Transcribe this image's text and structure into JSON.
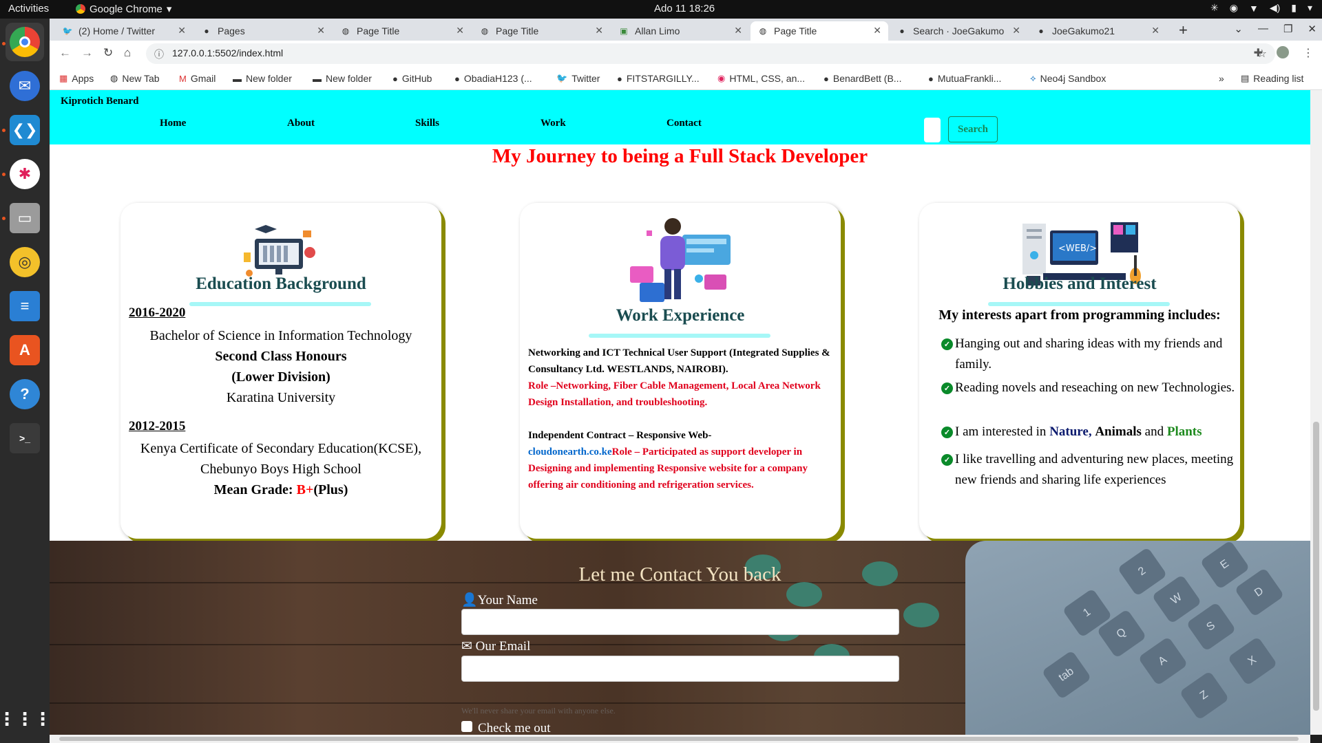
{
  "system": {
    "activities": "Activities",
    "app_name": "Google Chrome",
    "clock": "Ado 11  18:26"
  },
  "browser": {
    "tabs": [
      {
        "title": "(2) Home / Twitter",
        "icon": "twitter-icon"
      },
      {
        "title": "Pages",
        "icon": "github-icon"
      },
      {
        "title": "Page Title",
        "icon": "globe-icon"
      },
      {
        "title": "Page Title",
        "icon": "globe-icon"
      },
      {
        "title": "Allan Limo",
        "icon": "page-icon"
      },
      {
        "title": "Page Title",
        "icon": "globe-icon",
        "active": true
      },
      {
        "title": "Search · JoeGakumo",
        "icon": "github-icon"
      },
      {
        "title": "JoeGakumo21",
        "icon": "github-icon"
      }
    ],
    "url": "127.0.0.1:5502/index.html",
    "bookmarks": [
      "Apps",
      "New Tab",
      "Gmail",
      "New folder",
      "New folder",
      "GitHub",
      "ObadiaH123 (...",
      "Twitter",
      "FITSTARGILLY...",
      "HTML, CSS, an...",
      "BenardBett (B...",
      "MutuaFrankli...",
      "Neo4j Sandbox"
    ],
    "more_bookmarks": "»",
    "reading_list": "Reading list"
  },
  "site": {
    "brand": "Kiprotich Benard",
    "nav": [
      "Home",
      "About",
      "Skills",
      "Work",
      "Contact"
    ],
    "search_label": "Search",
    "heading": "My Journey to being a Full Stack Developer",
    "education": {
      "title": "Education Background",
      "year1": "2016-2020",
      "degree": "Bachelor of Science in Information Technology",
      "honours": "Second Class Honours",
      "division": "(Lower Division)",
      "university": "Karatina University",
      "year2": "2012-2015",
      "kcse": "Kenya Certificate of Secondary Education(KCSE),",
      "school": "Chebunyo Boys High School",
      "grade_label": "Mean Grade: ",
      "grade_value": "B+",
      "grade_suffix": "(Plus)"
    },
    "work": {
      "title": "Work Experience",
      "job1": "Networking and ICT Technical User Support (Integrated Supplies & Consultancy Ltd. WESTLANDS, NAIROBI).",
      "job1_role": "Role –Networking, Fiber Cable Management, Local Area Network Design Installation, and troubleshooting.",
      "job2": "Independent Contract – Responsive Web-",
      "job2_link": "cloudonearth.co.ke",
      "job2_role": "Role – Participated as support developer in Designing and implementing Responsive website for a company offering air conditioning and refrigeration services."
    },
    "hobbies": {
      "title": "Hobbies and Interest",
      "intro": "My interests apart from programming includes:",
      "item1": "Hanging out and sharing ideas with my friends and family.",
      "item2": "Reading novels and reseaching on new Technologies.",
      "item3_pre": "I am interested in ",
      "item3_a": "Nature,",
      "item3_b": "Animals",
      "item3_and": " and ",
      "item3_c": "Plants",
      "item4": "I like travelling and adventuring new places, meeting new friends and sharing life experiences"
    },
    "contact": {
      "title": "Let me Contact You back",
      "name_label": "Your Name",
      "email_label": "Our Email",
      "hint": "We'll never share your email with anyone else.",
      "check_label": "Check me out"
    }
  }
}
